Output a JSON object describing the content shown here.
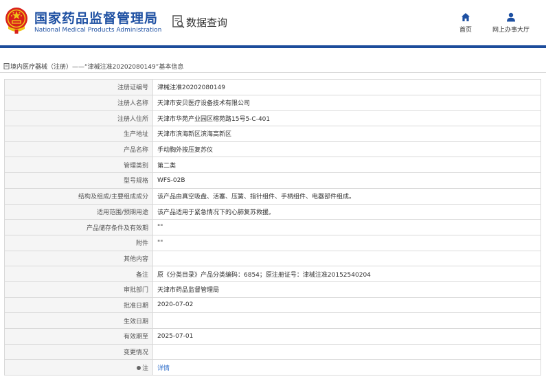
{
  "header": {
    "org_name_cn": "国家药品监督管理局",
    "org_name_en": "National Medical Products Administration",
    "query_title": "数据查询",
    "nav": {
      "home": "首页",
      "service_hall": "网上办事大厅"
    },
    "colors": {
      "brand_blue": "#1e50a2",
      "rule_blue": "#1c4c9b",
      "emblem_red": "#d9201b",
      "emblem_gold": "#f0c419"
    }
  },
  "breadcrumb": {
    "category": "境内医疗器械（注册）",
    "separator": "——",
    "record": "“津械注准20202080149”",
    "current": "基本信息"
  },
  "detail": {
    "rows": [
      {
        "label": "注册证编号",
        "value": "津械注准20202080149"
      },
      {
        "label": "注册人名称",
        "value": "天津市安贝医疗设备技术有限公司"
      },
      {
        "label": "注册人住所",
        "value": "天津市华苑产业园区榕苑路15号5-C-401"
      },
      {
        "label": "生产地址",
        "value": "天津市滨海新区滨海高新区"
      },
      {
        "label": "产品名称",
        "value": "手动胸外按压复苏仪"
      },
      {
        "label": "管理类别",
        "value": "第二类"
      },
      {
        "label": "型号规格",
        "value": "WFS-02B"
      },
      {
        "label": "结构及组成/主要组成成分",
        "value": "该产品由真空吸盘、活塞、压簧、指针组件、手柄组件、电器部件组成。"
      },
      {
        "label": "适用范围/预期用途",
        "value": "该产品适用于紧急情况下的心肺复苏救援。"
      },
      {
        "label": "产品储存条件及有效期",
        "value": "\"\""
      },
      {
        "label": "附件",
        "value": "\"\""
      },
      {
        "label": "其他内容",
        "value": ""
      },
      {
        "label": "备注",
        "value": "原《分类目录》产品分类编码：6854；原注册证号：津械注准20152540204"
      },
      {
        "label": "审批部门",
        "value": "天津市药品监督管理局"
      },
      {
        "label": "批准日期",
        "value": "2020-07-02"
      },
      {
        "label": "生效日期",
        "value": ""
      },
      {
        "label": "有效期至",
        "value": "2025-07-01"
      },
      {
        "label": "变更情况",
        "value": ""
      }
    ],
    "note_row": {
      "label": "注",
      "link": "详情"
    }
  }
}
